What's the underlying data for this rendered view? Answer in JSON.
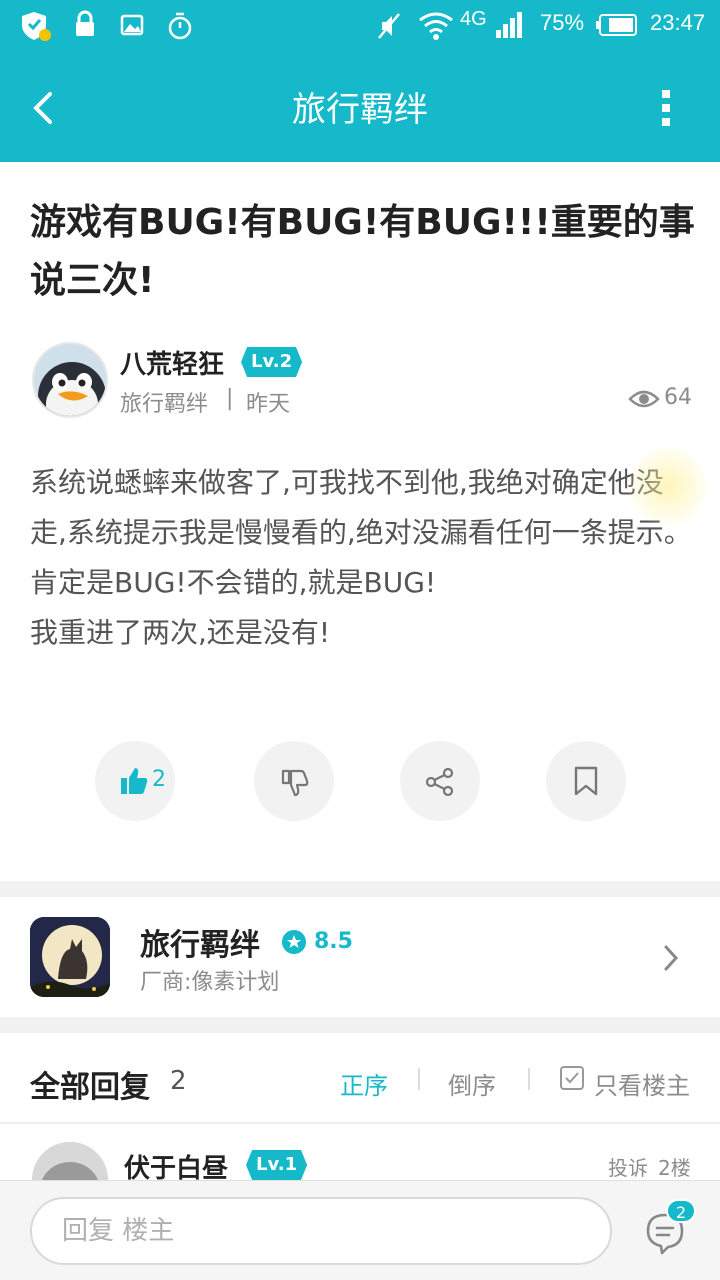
{
  "status_bar": {
    "network": "4G",
    "battery": "75%",
    "time": "23:47"
  },
  "app_bar": {
    "title": "旅行羁绊"
  },
  "post": {
    "title": "游戏有BUG!有BUG!有BUG!!!重要的事说三次!",
    "author": "八荒轻狂",
    "level": "Lv.2",
    "board": "旅行羁绊",
    "separator": "|",
    "time": "昨天",
    "views": "64",
    "content": "系统说蟋蟀来做客了,可我找不到他,我绝对确定他没走,系统提示我是慢慢看的,绝对没漏看任何一条提示。肯定是BUG!不会错的,就是BUG!\n我重进了两次,还是没有!",
    "like_count": "2"
  },
  "game_card": {
    "name": "旅行羁绊",
    "score": "8.5",
    "vendor": "厂商:像素计划"
  },
  "replies": {
    "heading": "全部回复",
    "count": "2",
    "sort_asc": "正序",
    "sort_desc": "倒序",
    "only_op": "只看楼主",
    "first_reply": {
      "name": "伏于白昼",
      "level": "Lv.1",
      "report": "投诉",
      "floor": "2楼"
    }
  },
  "bottom_bar": {
    "placeholder": "回复  楼主",
    "comment_badge": "2"
  },
  "colors": {
    "accent": "#15b9c9",
    "secondary_text": "#8c8c8c",
    "divider": "#f1f1f1"
  }
}
